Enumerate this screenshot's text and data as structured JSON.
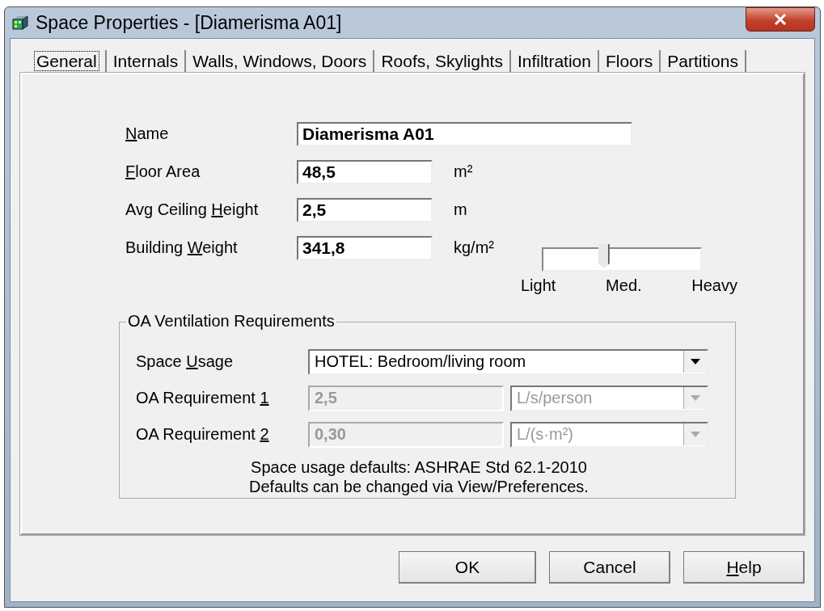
{
  "window": {
    "title": "Space Properties - [Diamerisma A01]"
  },
  "tabs": [
    {
      "label": "General",
      "selected": true
    },
    {
      "label": "Internals",
      "selected": false
    },
    {
      "label": "Walls, Windows, Doors",
      "selected": false
    },
    {
      "label": "Roofs, Skylights",
      "selected": false
    },
    {
      "label": "Infiltration",
      "selected": false
    },
    {
      "label": "Floors",
      "selected": false
    },
    {
      "label": "Partitions",
      "selected": false
    }
  ],
  "fields": [
    {
      "label": {
        "key": "N",
        "post": "ame"
      },
      "value": "Diamerisma A01",
      "kind": "wide"
    },
    {
      "label": {
        "key": "F",
        "post": "loor Area"
      },
      "value": "48,5",
      "unit": "m²",
      "kind": "short"
    },
    {
      "label": {
        "pre": "Avg Ceiling ",
        "key": "H",
        "post": "eight"
      },
      "value": "2,5",
      "unit": "m",
      "kind": "short"
    },
    {
      "label": {
        "pre": "Building ",
        "key": "W",
        "post": "eight"
      },
      "value": "341,8",
      "unit": "kg/m²",
      "kind": "short"
    }
  ],
  "weight_slider": {
    "level": 0.38,
    "ticks": [
      "Light",
      "Med.",
      "Heavy"
    ]
  },
  "oa_group": {
    "title": "OA Ventilation Requirements",
    "space_usage": {
      "label": {
        "pre": "Space ",
        "key": "U",
        "post": "sage"
      },
      "value": "HOTEL: Bedroom/living room"
    },
    "requirements": [
      {
        "label": {
          "pre": "OA Requirement ",
          "key": "1"
        },
        "value": "2,5",
        "unit": "L/s/person",
        "disabled": true
      },
      {
        "label": {
          "pre": "OA Requirement ",
          "key": "2"
        },
        "value": "0,30",
        "unit": "L/(s·m²)",
        "disabled": true
      }
    ],
    "note": [
      "Space usage defaults: ASHRAE Std 62.1-2010",
      "Defaults can be changed via View/Preferences."
    ]
  },
  "buttons": [
    {
      "label": {
        "pre": "OK"
      }
    },
    {
      "label": {
        "pre": "Cancel"
      }
    },
    {
      "label": {
        "key": "H",
        "post": "elp"
      }
    }
  ]
}
